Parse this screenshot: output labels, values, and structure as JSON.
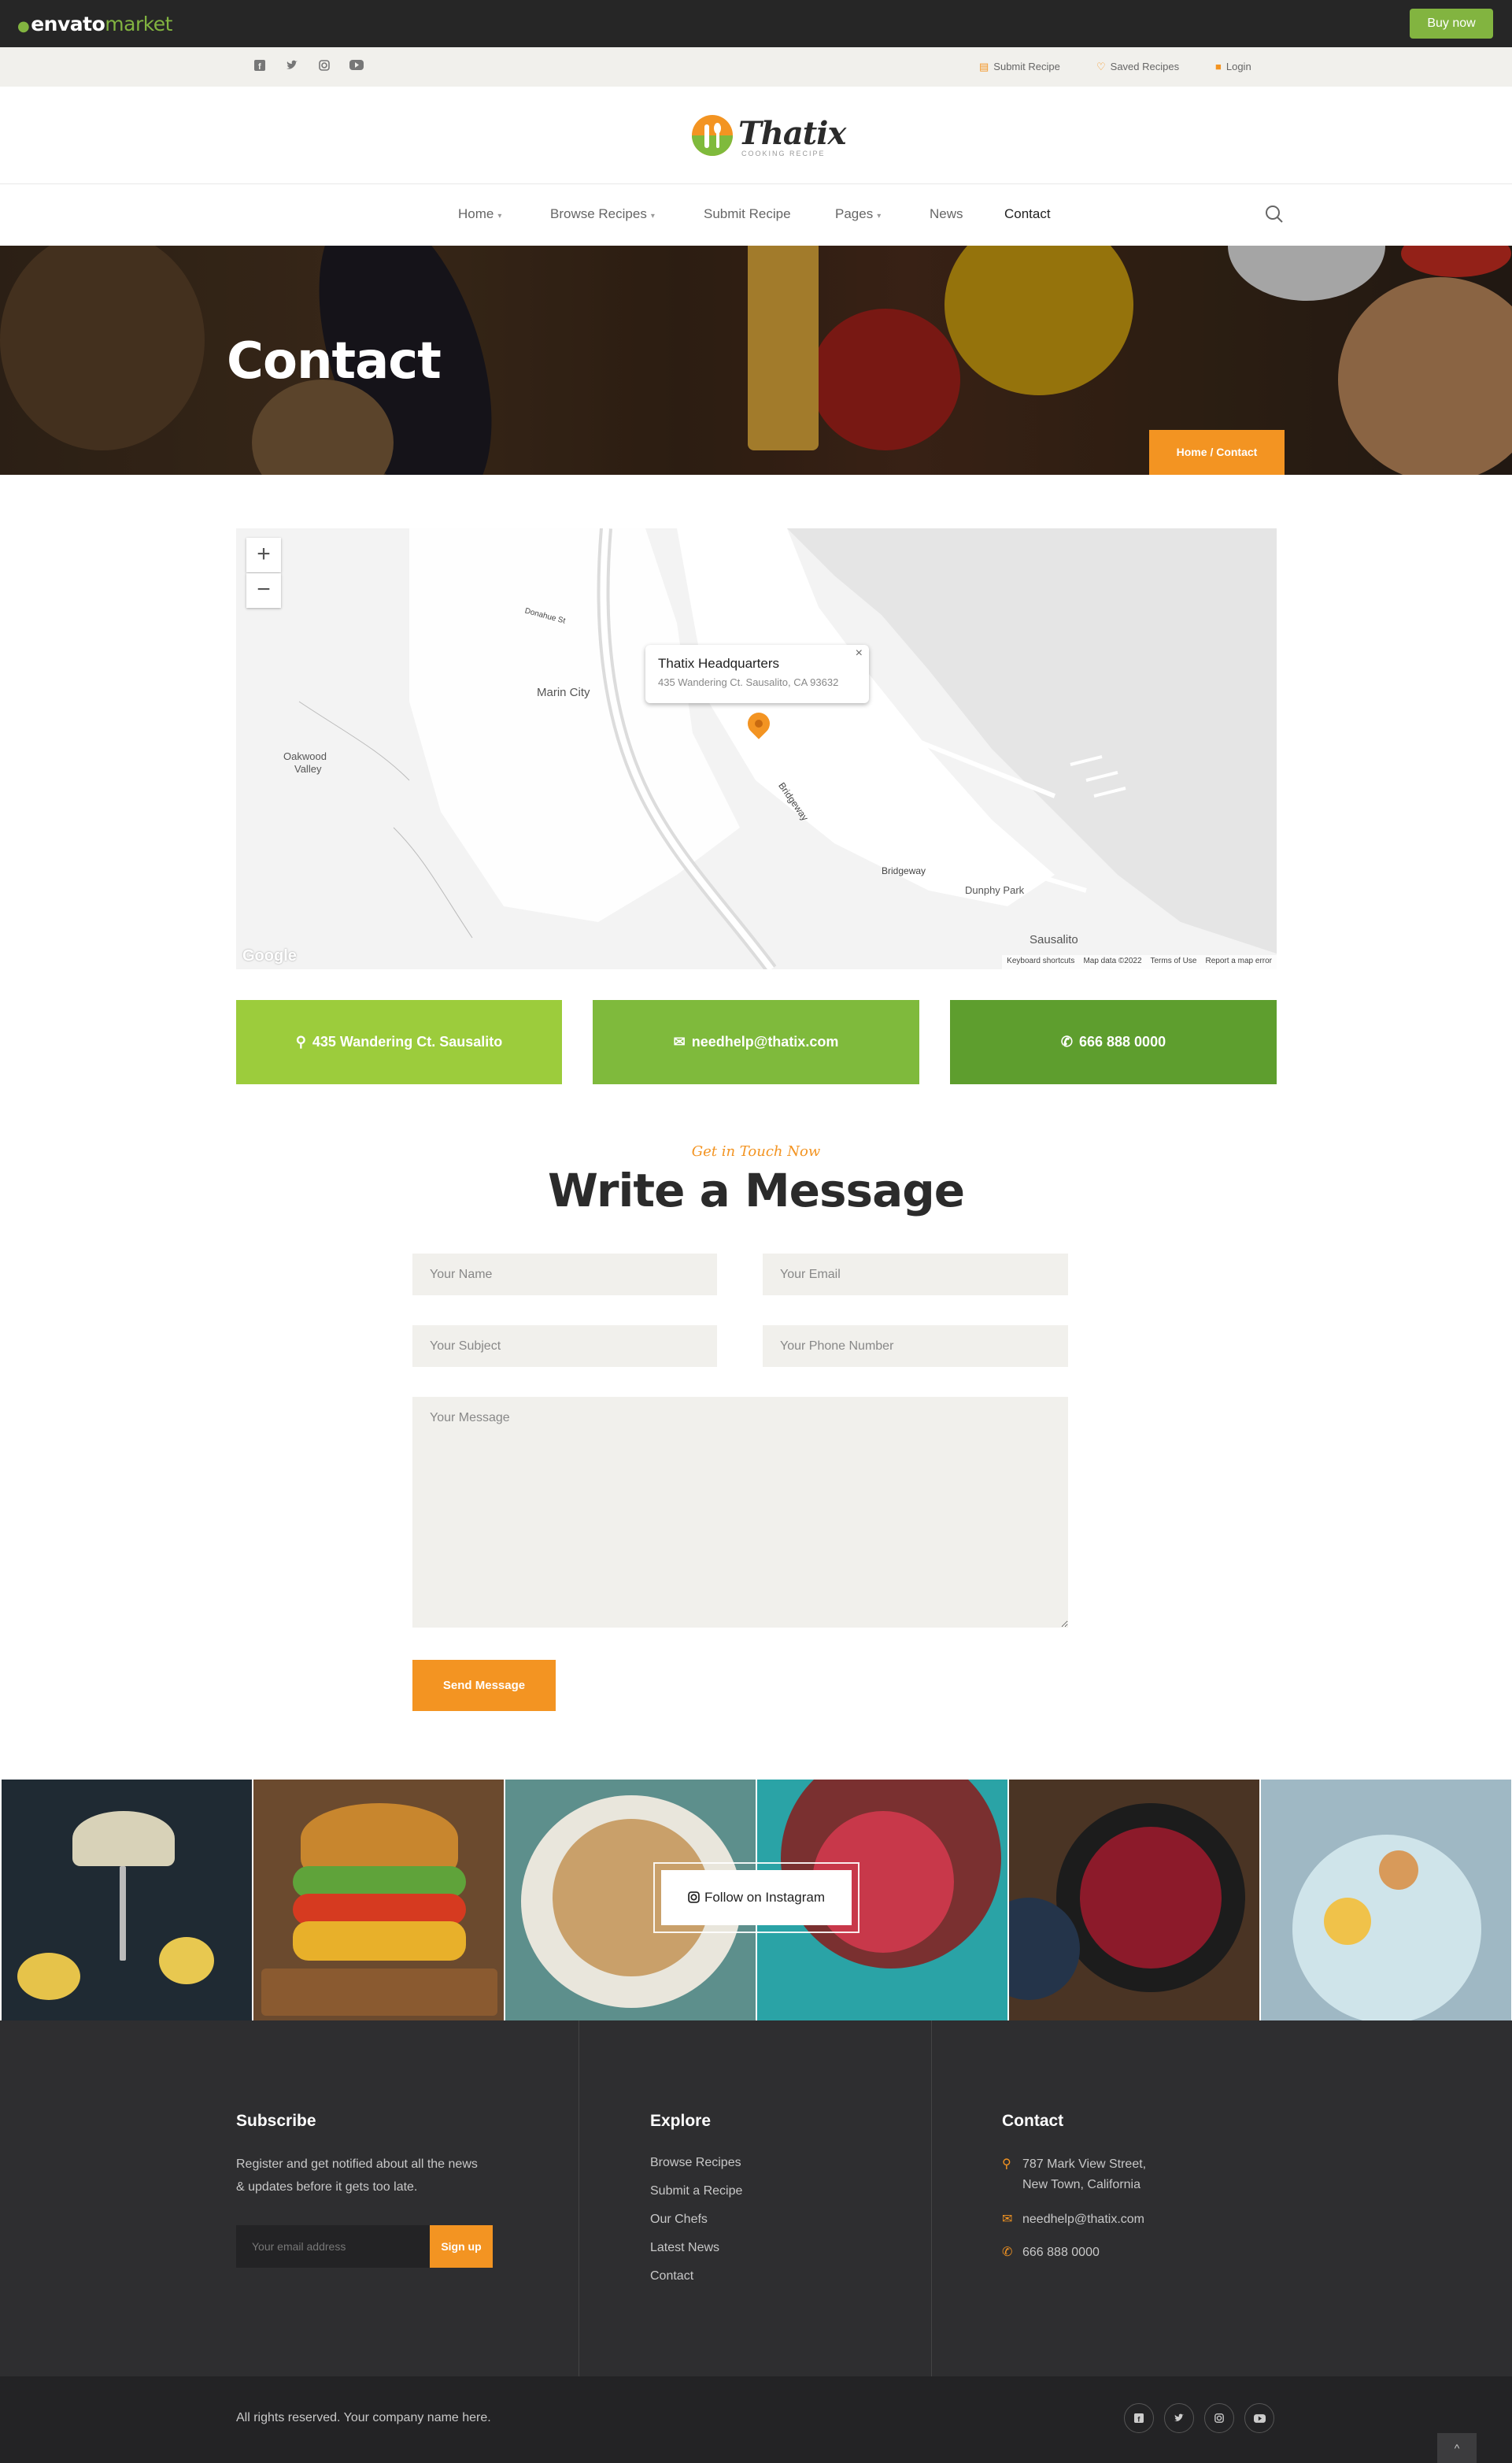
{
  "envato": {
    "logo_brand": "envato",
    "logo_market": "market",
    "buy_label": "Buy now"
  },
  "topbar": {
    "socials": [
      "facebook-icon",
      "twitter-icon",
      "instagram-icon",
      "youtube-icon"
    ],
    "links": {
      "submit": "Submit Recipe",
      "saved": "Saved Recipes",
      "login": "Login"
    }
  },
  "logo": {
    "name": "Thatix",
    "tagline": "COOKING RECIPE"
  },
  "nav": {
    "home": "Home",
    "browse": "Browse Recipes",
    "submit": "Submit Recipe",
    "pages": "Pages",
    "news": "News",
    "contact": "Contact"
  },
  "banner": {
    "title": "Contact",
    "crumb_home": "Home",
    "crumb_sep": "/",
    "crumb_current": "Contact"
  },
  "map": {
    "zoom_in": "+",
    "zoom_out": "−",
    "popup_title": "Thatix Headquarters",
    "popup_address": "435 Wandering Ct. Sausalito, CA 93632",
    "labels": {
      "marin_city": "Marin City",
      "oakwood": "Oakwood",
      "valley": "Valley",
      "sausalito": "Sausalito",
      "dunphy": "Dunphy Park",
      "bridgeway": "Bridgeway",
      "bridgeway2": "Bridgeway",
      "donahue": "Donahue St"
    },
    "google": "Google",
    "footer": {
      "shortcuts": "Keyboard shortcuts",
      "data": "Map data ©2022",
      "terms": "Terms of Use",
      "report": "Report a map error"
    }
  },
  "contact_boxes": {
    "address": "435 Wandering Ct. Sausalito",
    "email": "needhelp@thatix.com",
    "phone": "666 888 0000"
  },
  "form": {
    "kicker": "Get in Touch Now",
    "title": "Write a Message",
    "name_ph": "Your Name",
    "email_ph": "Your Email",
    "subject_ph": "Your Subject",
    "phone_ph": "Your Phone Number",
    "message_ph": "Your Message",
    "send": "Send Message"
  },
  "instagram": {
    "follow": "Follow on Instagram"
  },
  "footer": {
    "subscribe_title": "Subscribe",
    "subscribe_text_1": "Register and get notified about all the news",
    "subscribe_text_2": "& updates before it gets too late.",
    "email_ph": "Your email address",
    "signup": "Sign up",
    "explore_title": "Explore",
    "explore_links": [
      "Browse Recipes",
      "Submit a Recipe",
      "Our Chefs",
      "Latest News",
      "Contact"
    ],
    "contact_title": "Contact",
    "address_1": "787 Mark View Street,",
    "address_2": "New Town, California",
    "email": "needhelp@thatix.com",
    "phone": "666 888 0000"
  },
  "bottom": {
    "copyright": "All rights reserved. Your company name here.",
    "to_top": "^"
  },
  "colors": {
    "accent": "#f39422",
    "green_1": "#9ccc3c",
    "green_2": "#7fba3c",
    "green_3": "#5e9e2e",
    "envato_green": "#82b440"
  }
}
